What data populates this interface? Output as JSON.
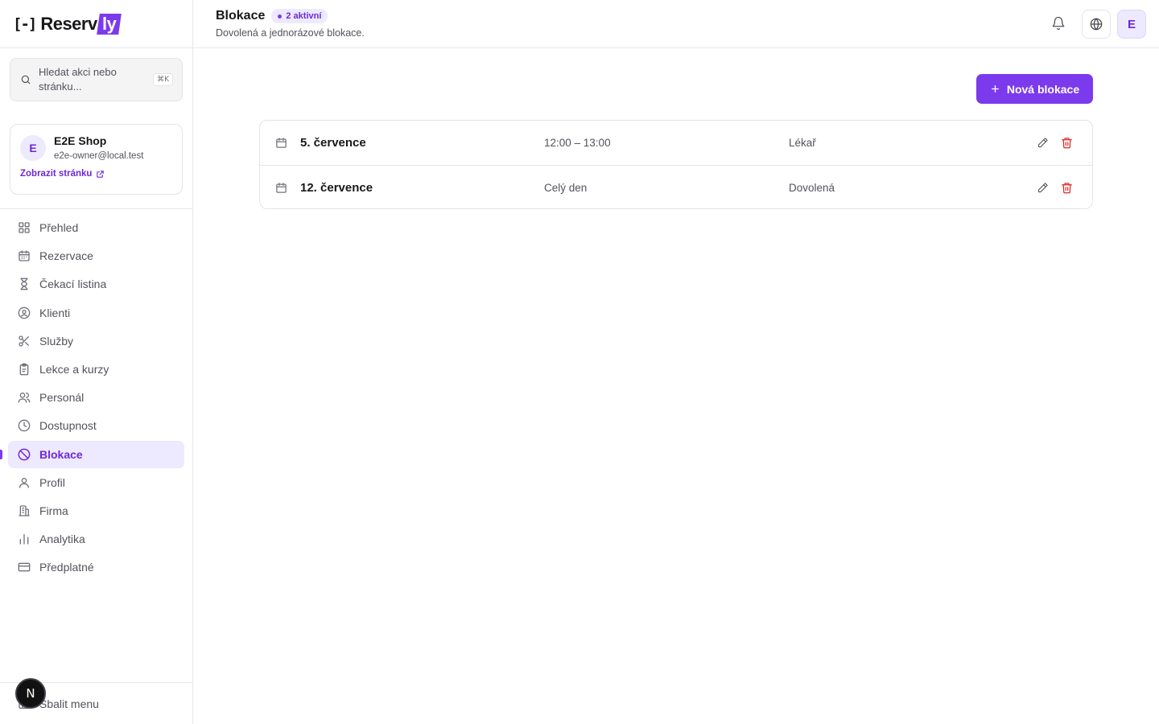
{
  "brand": {
    "logo_bracket": "[-]",
    "logo_main": "Reserv",
    "logo_accent": "ly"
  },
  "search": {
    "placeholder": "Hledat akci nebo stránku...",
    "shortcut": "⌘K"
  },
  "account": {
    "avatar_initial": "E",
    "name": "E2E Shop",
    "email": "e2e-owner@local.test",
    "link_label": "Zobrazit stránku"
  },
  "nav": {
    "items": [
      {
        "label": "Přehled",
        "icon": "grid-icon"
      },
      {
        "label": "Rezervace",
        "icon": "calendar-icon"
      },
      {
        "label": "Čekací listina",
        "icon": "hourglass-icon"
      },
      {
        "label": "Klienti",
        "icon": "user-circle-icon"
      },
      {
        "label": "Služby",
        "icon": "scissors-icon"
      },
      {
        "label": "Lekce a kurzy",
        "icon": "clipboard-icon"
      },
      {
        "label": "Personál",
        "icon": "users-icon"
      },
      {
        "label": "Dostupnost",
        "icon": "clock-icon"
      },
      {
        "label": "Blokace",
        "icon": "ban-icon",
        "active": true
      },
      {
        "label": "Profil",
        "icon": "user-icon"
      },
      {
        "label": "Firma",
        "icon": "building-icon"
      },
      {
        "label": "Analytika",
        "icon": "bar-chart-icon"
      },
      {
        "label": "Předplatné",
        "icon": "credit-card-icon"
      }
    ],
    "collapse_label": "Sbalit menu"
  },
  "dev_badge": {
    "label": "N"
  },
  "header": {
    "title": "Blokace",
    "badge": "2 aktivní",
    "subtitle": "Dovolená a jednorázové blokace.",
    "user_initial": "E"
  },
  "main": {
    "new_button_label": "Nová blokace",
    "blocks": [
      {
        "date": "5. července",
        "time": "12:00 – 13:00",
        "reason": "Lékař"
      },
      {
        "date": "12. července",
        "time": "Celý den",
        "reason": "Dovolená"
      }
    ]
  },
  "colors": {
    "accent": "#7c3aed",
    "accent_soft": "#ede9fe",
    "danger": "#dc2626",
    "border": "#e4e4e7"
  }
}
